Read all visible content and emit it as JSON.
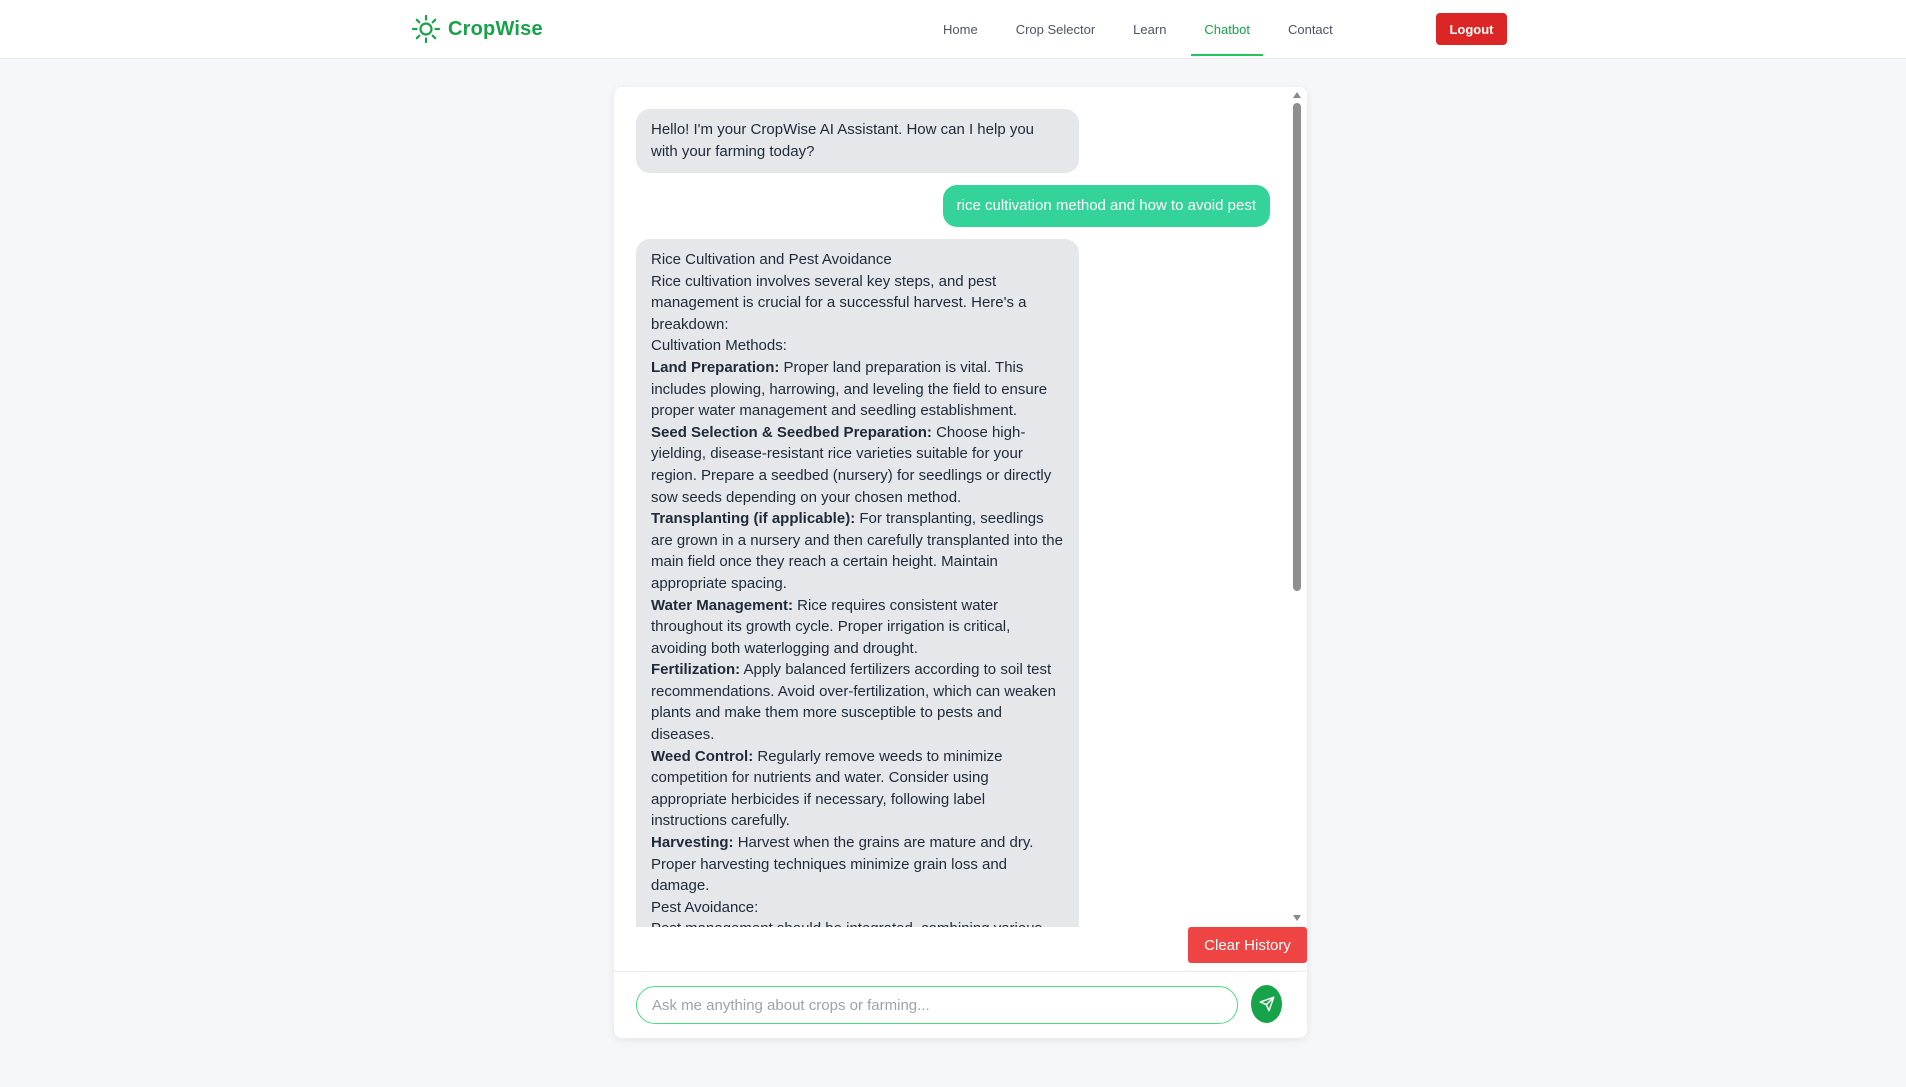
{
  "brand": {
    "name": "CropWise",
    "icon": "sun-icon",
    "color": "#16a34a"
  },
  "nav": {
    "items": [
      {
        "label": "Home",
        "active": false
      },
      {
        "label": "Crop Selector",
        "active": false
      },
      {
        "label": "Learn",
        "active": false
      },
      {
        "label": "Chatbot",
        "active": true
      },
      {
        "label": "Contact",
        "active": false
      }
    ],
    "logout_label": "Logout"
  },
  "chat": {
    "greeting": "Hello! I'm your CropWise AI Assistant. How can I help you with your farming today?",
    "user_message": "rice cultivation method and how to avoid pest",
    "answer": {
      "title": "Rice Cultivation and Pest Avoidance",
      "intro": "Rice cultivation involves several key steps, and pest management is crucial for a successful harvest. Here's a breakdown:",
      "methods_heading": "Cultivation Methods:",
      "methods": [
        {
          "term": "Land Preparation:",
          "text": " Proper land preparation is vital. This includes plowing, harrowing, and leveling the field to ensure proper water management and seedling establishment."
        },
        {
          "term": "Seed Selection & Seedbed Preparation:",
          "text": " Choose high-yielding, disease-resistant rice varieties suitable for your region. Prepare a seedbed (nursery) for seedlings or directly sow seeds depending on your chosen method."
        },
        {
          "term": "Transplanting (if applicable):",
          "text": " For transplanting, seedlings are grown in a nursery and then carefully transplanted into the main field once they reach a certain height. Maintain appropriate spacing."
        },
        {
          "term": "Water Management:",
          "text": " Rice requires consistent water throughout its growth cycle. Proper irrigation is critical, avoiding both waterlogging and drought."
        },
        {
          "term": "Fertilization:",
          "text": " Apply balanced fertilizers according to soil test recommendations. Avoid over-fertilization, which can weaken plants and make them more susceptible to pests and diseases."
        },
        {
          "term": "Weed Control:",
          "text": " Regularly remove weeds to minimize competition for nutrients and water. Consider using appropriate herbicides if necessary, following label instructions carefully."
        },
        {
          "term": "Harvesting:",
          "text": " Harvest when the grains are mature and dry. Proper harvesting techniques minimize grain loss and damage."
        }
      ],
      "pest_heading": "Pest Avoidance:",
      "pest_intro": "Pest management should be integrated, combining various"
    },
    "clear_label": "Clear History",
    "input_placeholder": "Ask me anything about crops or farming...",
    "input_value": "",
    "send_icon": "send-icon"
  },
  "colors": {
    "accent": "#16a34a",
    "user_bubble": "#34d399",
    "bot_bubble": "#e5e7eb",
    "logout": "#dc2626",
    "clear": "#ef4444"
  }
}
